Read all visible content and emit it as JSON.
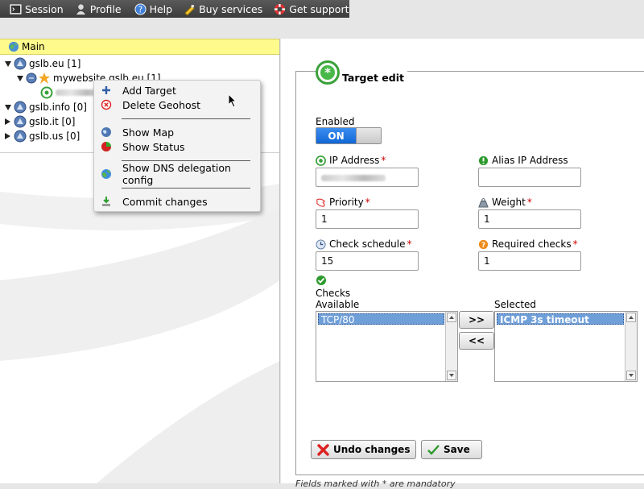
{
  "topmenu": {
    "items": [
      {
        "label": "Session",
        "icon": "terminal-icon"
      },
      {
        "label": "Profile",
        "icon": "user-icon"
      },
      {
        "label": "Help",
        "icon": "help-icon"
      },
      {
        "label": "Buy services",
        "icon": "cart-icon"
      },
      {
        "label": "Get support",
        "icon": "lifebuoy-icon"
      }
    ]
  },
  "tree": {
    "header": "Main",
    "nodes": [
      {
        "label": "gslb.eu [1]"
      },
      {
        "label": "mywebsite.gslb.eu [1]"
      },
      {
        "label": "gslb.info [0]"
      },
      {
        "label": "gslb.it [0]"
      },
      {
        "label": "gslb.us [0]"
      }
    ]
  },
  "context_menu": {
    "items": [
      {
        "label": "Add Target"
      },
      {
        "label": "Delete Geohost"
      },
      {
        "label": "Show Map"
      },
      {
        "label": "Show Status"
      },
      {
        "label": "Show DNS delegation config"
      },
      {
        "label": "Commit changes"
      }
    ]
  },
  "form": {
    "legend": "Target edit",
    "enabled_label": "Enabled",
    "toggle_label": "ON",
    "ip_label": "IP Address",
    "alias_label": "Alias IP Address",
    "alias_value": "",
    "priority_label": "Priority",
    "priority_value": "1",
    "weight_label": "Weight",
    "weight_value": "1",
    "schedule_label": "Check schedule",
    "schedule_value": "15",
    "required_label": "Required checks",
    "required_value": "1",
    "checks_label": "Checks",
    "available_label": "Available",
    "selected_label": "Selected",
    "available_items": [
      "TCP/80"
    ],
    "selected_items": [
      "ICMP 3s timeout"
    ],
    "add_btn": ">>",
    "remove_btn": "<<",
    "undo_label": "Undo changes",
    "save_label": "Save",
    "required_mark": "*"
  },
  "footnote": "Fields marked with * are mandatory",
  "colors": {
    "main_bar": "#fefb8c",
    "toggle_on": "#1167d6",
    "selection": "#6f9fd8",
    "required": "#cc0000"
  }
}
